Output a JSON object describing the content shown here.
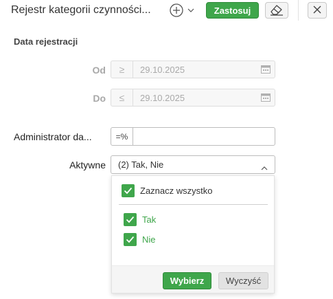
{
  "header": {
    "title": "Rejestr kategorii czynności...",
    "apply_label": "Zastosuj",
    "add_icon": "plus-circle-icon",
    "eraser_icon": "eraser-icon",
    "close_icon": "close-icon"
  },
  "section": {
    "title": "Data rejestracji"
  },
  "date_from": {
    "label": "Od",
    "operator": "≥",
    "value": "29.10.2025"
  },
  "date_to": {
    "label": "Do",
    "operator": "≤",
    "value": "29.10.2025"
  },
  "admin_field": {
    "label": "Administrator da...",
    "operator": "=%",
    "value": ""
  },
  "active_field": {
    "label": "Aktywne",
    "value": "(2) Tak, Nie"
  },
  "dropdown": {
    "select_all_label": "Zaznacz wszystko",
    "select_all_checked": true,
    "options": [
      {
        "label": "Tak",
        "checked": true
      },
      {
        "label": "Nie",
        "checked": true
      }
    ],
    "choose_label": "Wybierz",
    "clear_label": "Wyczyść"
  },
  "colors": {
    "accent": "#3fa64b"
  }
}
